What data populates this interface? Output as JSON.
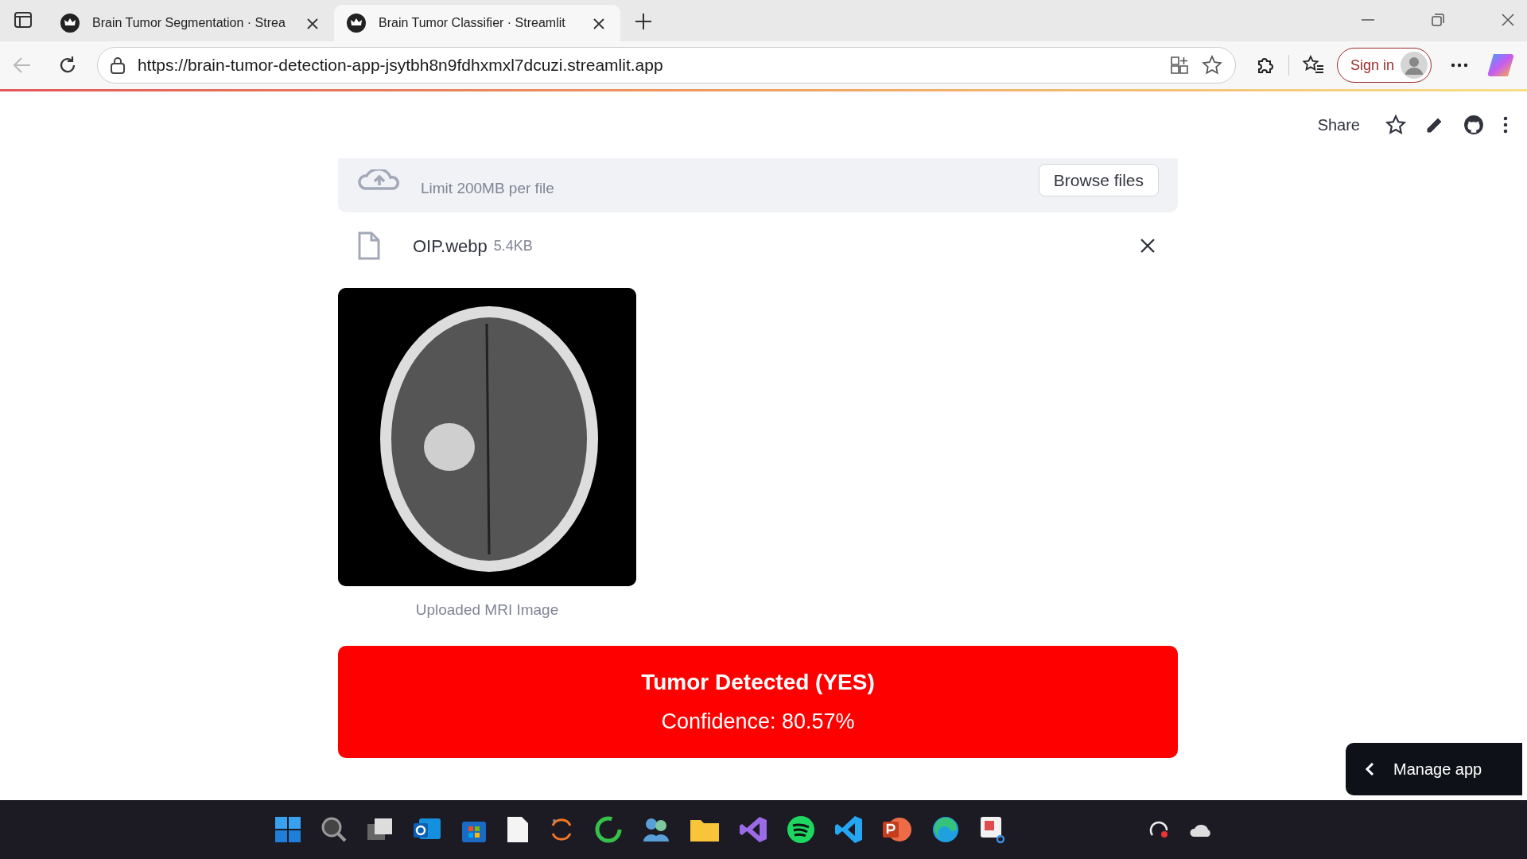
{
  "browser": {
    "tabs": [
      {
        "title": "Brain Tumor Segmentation · Strea",
        "selected": false
      },
      {
        "title": "Brain Tumor Classifier · Streamlit",
        "selected": true
      }
    ],
    "url": "https://brain-tumor-detection-app-jsytbh8n9fdhxmxl7dcuzi.streamlit.app",
    "sign_in": "Sign in"
  },
  "app": {
    "share": "Share",
    "uploader": {
      "limit": "Limit 200MB per file",
      "browse": "Browse files"
    },
    "file": {
      "name": "OIP.webp",
      "size": "5.4KB"
    },
    "image_caption": "Uploaded MRI Image",
    "result": {
      "title": "Tumor Detected (YES)",
      "confidence": "Confidence: 80.57%"
    },
    "manage_app": "Manage app"
  }
}
